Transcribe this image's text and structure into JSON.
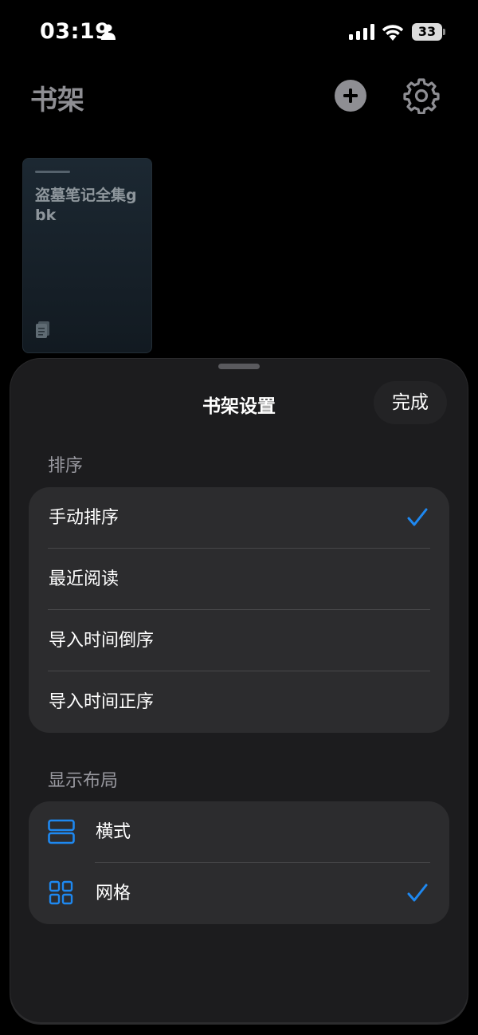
{
  "status_bar": {
    "time": "03:19",
    "battery_level": "33"
  },
  "header": {
    "title": "书架"
  },
  "books": [
    {
      "title": "盗墓笔记全集gbk"
    }
  ],
  "sheet": {
    "title": "书架设置",
    "done_label": "完成",
    "sort_section": {
      "header": "排序",
      "options": [
        {
          "label": "手动排序",
          "selected": true
        },
        {
          "label": "最近阅读",
          "selected": false
        },
        {
          "label": "导入时间倒序",
          "selected": false
        },
        {
          "label": "导入时间正序",
          "selected": false
        }
      ]
    },
    "layout_section": {
      "header": "显示布局",
      "options": [
        {
          "label": "横式",
          "icon": "list-layout-icon",
          "selected": false
        },
        {
          "label": "网格",
          "icon": "grid-layout-icon",
          "selected": true
        }
      ]
    }
  },
  "colors": {
    "accent": "#1E88F0",
    "sheet_bg": "#1C1C1E",
    "group_bg": "#2C2C2E",
    "secondary_text": "#8E8E93"
  }
}
